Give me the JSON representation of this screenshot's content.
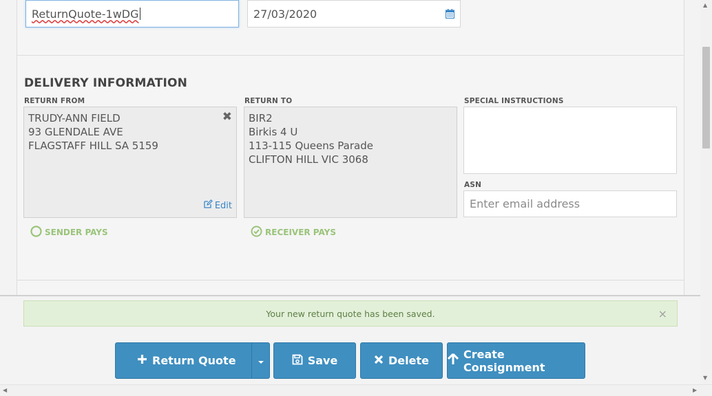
{
  "form": {
    "reference_value": "ReturnQuote-1wDG",
    "date_value": "27/03/2020"
  },
  "delivery": {
    "section_title": "DELIVERY INFORMATION",
    "return_from": {
      "label": "RETURN FROM",
      "lines": [
        "TRUDY-ANN FIELD",
        "93 GLENDALE AVE",
        "FLAGSTAFF HILL SA 5159"
      ],
      "edit_label": "Edit"
    },
    "return_to": {
      "label": "RETURN TO",
      "lines": [
        "BIR2",
        "Birkis 4 U",
        "113-115 Queens Parade",
        "CLIFTON HILL VIC 3068"
      ]
    },
    "special_instructions": {
      "label": "SPECIAL INSTRUCTIONS",
      "value": ""
    },
    "asn": {
      "label": "ASN",
      "placeholder": "Enter email address"
    },
    "sender_pays": {
      "label": "SENDER PAYS",
      "checked": false
    },
    "receiver_pays": {
      "label": "RECEIVER PAYS",
      "checked": true
    }
  },
  "alert": {
    "message": "Your new return quote has been saved.",
    "close_symbol": "×"
  },
  "actions": {
    "return_quote": "Return Quote",
    "save": "Save",
    "delete": "Delete",
    "create_consignment": "Create Consignment"
  },
  "colors": {
    "button_blue": "#3f8fc0",
    "success_green": "#9ac47a",
    "alert_bg": "#e3f0d9",
    "link_blue": "#3a86c8"
  },
  "icons": [
    "calendar-icon",
    "close-icon",
    "edit-icon",
    "circle-icon",
    "check-circle-icon",
    "plus-icon",
    "caret-down-icon",
    "save-icon",
    "x-icon",
    "arrow-up-icon"
  ]
}
